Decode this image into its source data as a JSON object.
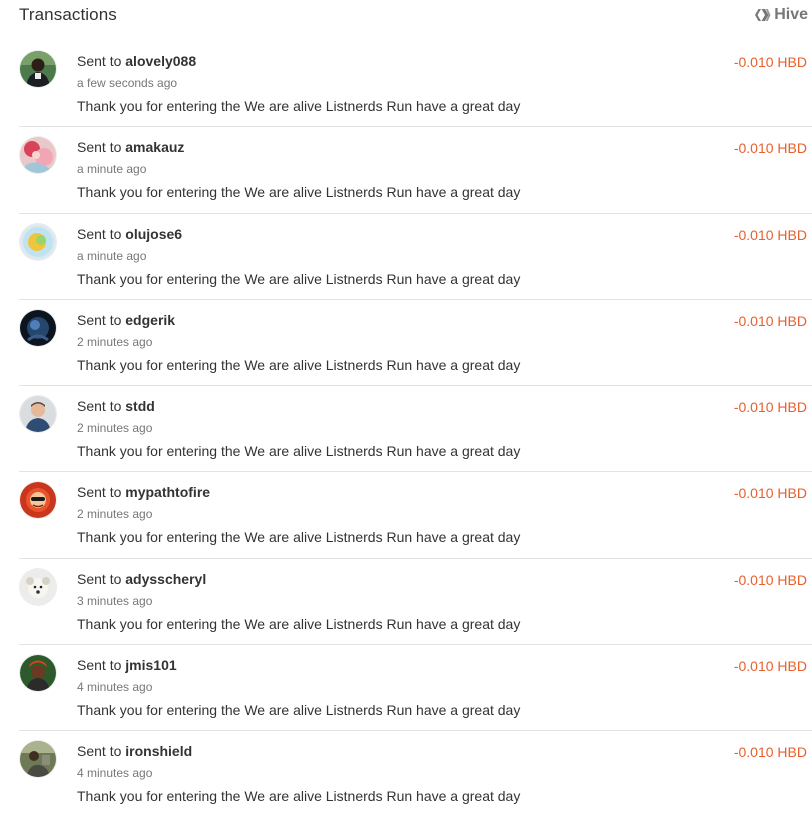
{
  "header": {
    "title": "Transactions",
    "brand_label": "Hive",
    "brand_icon": "hive-logo-icon"
  },
  "colors": {
    "amount": "#e8602c",
    "text": "#333333",
    "muted": "#777777",
    "divider": "#e3e3e3"
  },
  "transactions": [
    {
      "prefix": "Sent to",
      "user": "alovely088",
      "time": "a few seconds ago",
      "memo": "Thank you for entering the We are alive Listnerds Run have a great day",
      "amount": "-0.010 HBD",
      "avatar": "avatar-alovely088"
    },
    {
      "prefix": "Sent to",
      "user": "amakauz",
      "time": "a minute ago",
      "memo": "Thank you for entering the We are alive Listnerds Run have a great day",
      "amount": "-0.010 HBD",
      "avatar": "avatar-amakauz"
    },
    {
      "prefix": "Sent to",
      "user": "olujose6",
      "time": "a minute ago",
      "memo": "Thank you for entering the We are alive Listnerds Run have a great day",
      "amount": "-0.010 HBD",
      "avatar": "avatar-olujose6"
    },
    {
      "prefix": "Sent to",
      "user": "edgerik",
      "time": "2 minutes ago",
      "memo": "Thank you for entering the We are alive Listnerds Run have a great day",
      "amount": "-0.010 HBD",
      "avatar": "avatar-edgerik"
    },
    {
      "prefix": "Sent to",
      "user": "stdd",
      "time": "2 minutes ago",
      "memo": "Thank you for entering the We are alive Listnerds Run have a great day",
      "amount": "-0.010 HBD",
      "avatar": "avatar-stdd"
    },
    {
      "prefix": "Sent to",
      "user": "mypathtofire",
      "time": "2 minutes ago",
      "memo": "Thank you for entering the We are alive Listnerds Run have a great day",
      "amount": "-0.010 HBD",
      "avatar": "avatar-mypathtofire"
    },
    {
      "prefix": "Sent to",
      "user": "adysscheryl",
      "time": "3 minutes ago",
      "memo": "Thank you for entering the We are alive Listnerds Run have a great day",
      "amount": "-0.010 HBD",
      "avatar": "avatar-adysscheryl"
    },
    {
      "prefix": "Sent to",
      "user": "jmis101",
      "time": "4 minutes ago",
      "memo": "Thank you for entering the We are alive Listnerds Run have a great day",
      "amount": "-0.010 HBD",
      "avatar": "avatar-jmis101"
    },
    {
      "prefix": "Sent to",
      "user": "ironshield",
      "time": "4 minutes ago",
      "memo": "Thank you for entering the We are alive Listnerds Run have a great day",
      "amount": "-0.010 HBD",
      "avatar": "avatar-ironshield"
    }
  ]
}
